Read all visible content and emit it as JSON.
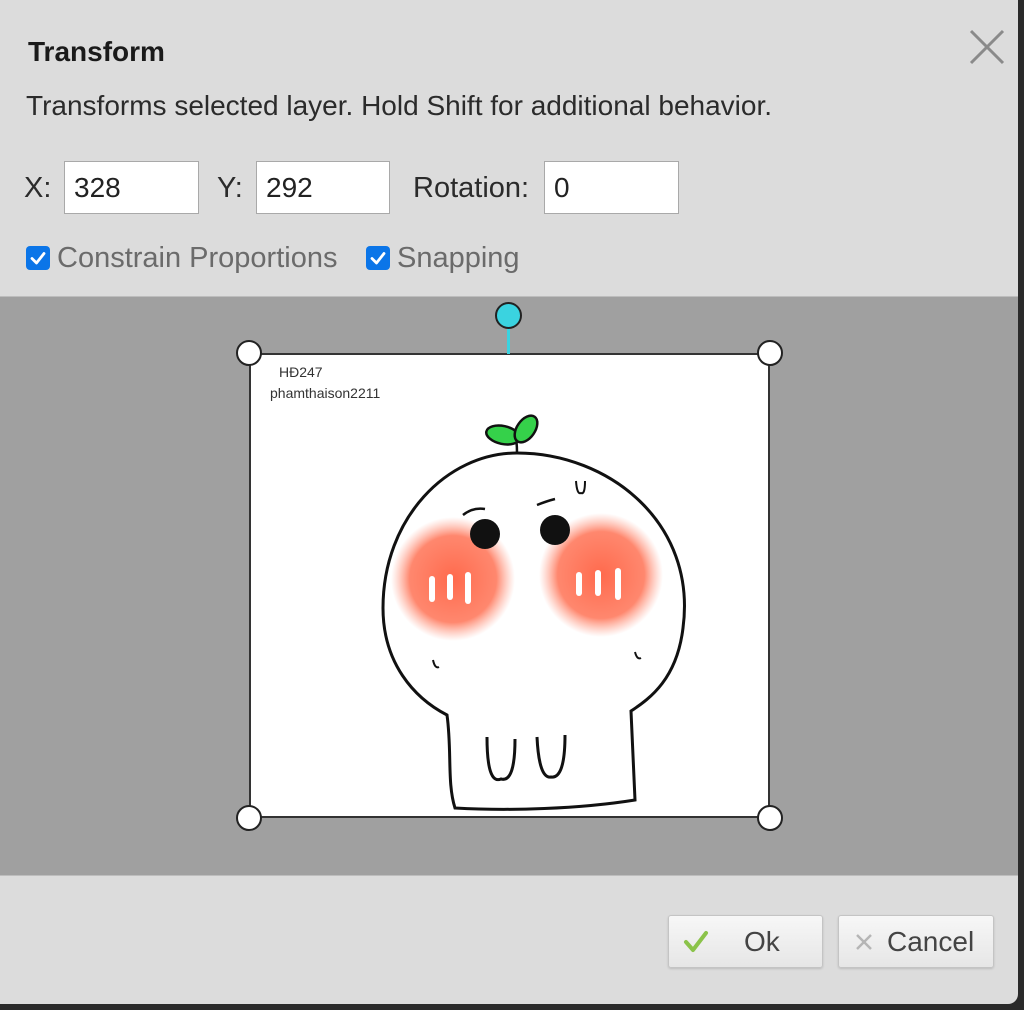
{
  "dialog": {
    "title": "Transform",
    "description": "Transforms selected layer. Hold Shift for additional behavior."
  },
  "fields": {
    "x_label": "X:",
    "x_value": "328",
    "y_label": "Y:",
    "y_value": "292",
    "rotation_label": "Rotation:",
    "rotation_value": "0"
  },
  "options": {
    "constrain_label": "Constrain Proportions",
    "constrain_checked": true,
    "snapping_label": "Snapping",
    "snapping_checked": true
  },
  "layer": {
    "watermark_line1": "HĐ247",
    "watermark_line2": "phamthaison2211"
  },
  "footer": {
    "ok_label": "Ok",
    "cancel_label": "Cancel"
  },
  "colors": {
    "accent_check": "#0b75e8",
    "rotate_handle": "#3ad3e0",
    "ok_icon": "#8bc34a",
    "canvas_bg": "#a0a0a0",
    "dialog_bg": "#dcdcdc"
  },
  "icons": {
    "close": "close-icon",
    "ok": "checkmark-icon",
    "cancel": "x-icon"
  }
}
